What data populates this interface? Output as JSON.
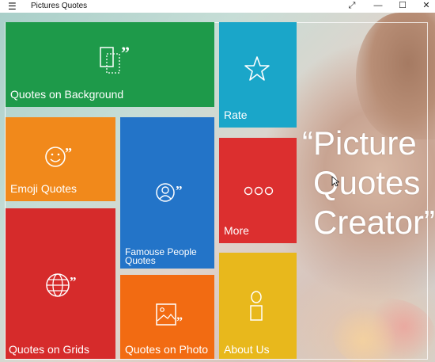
{
  "window": {
    "title": "Pictures Quotes",
    "menu_icon": "hamburger-icon",
    "controls": [
      "resize-icon",
      "minimize-icon",
      "maximize-icon",
      "close-icon"
    ]
  },
  "tiles": {
    "quotes_on_background": {
      "label": "Quotes on Background",
      "icon": "background-quote-icon",
      "color": "#1e9a4a"
    },
    "rate": {
      "label": "Rate",
      "icon": "star-icon",
      "color": "#1aa6c9"
    },
    "emoji_quotes": {
      "label": "Emoji Quotes",
      "icon": "smiley-quote-icon",
      "color": "#f1891b"
    },
    "famous_people_quotes": {
      "label": "Famouse People Quotes",
      "icon": "person-quote-icon",
      "color": "#2374c8"
    },
    "more": {
      "label": "More",
      "icon": "more-dots-icon",
      "color": "#dc2f2f"
    },
    "quotes_on_grids": {
      "label": "Quotes on Grids",
      "icon": "globe-quote-icon",
      "color": "#d62b2b"
    },
    "quotes_on_photo": {
      "label": "Quotes on Photo",
      "icon": "photo-quote-icon",
      "color": "#f26b12"
    },
    "about_us": {
      "label": "About Us",
      "icon": "person-outline-icon",
      "color": "#e8b81c"
    }
  },
  "headline": {
    "line1": "“Picture",
    "line2": "Quotes",
    "line3": "Creator”"
  }
}
